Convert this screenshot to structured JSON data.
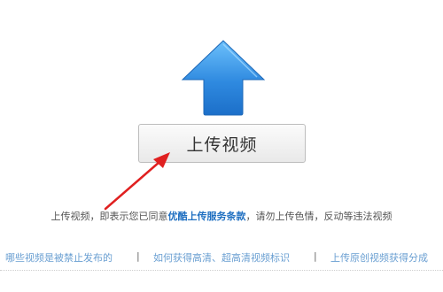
{
  "upload": {
    "button_label": "上传视频",
    "icon": "upload-arrow-icon",
    "accent_color": "#2f8ae0"
  },
  "agreement": {
    "prefix": "上传视频，即表示您已同意",
    "link": "优酷上传服务条款",
    "suffix": "，请勿上传色情，反动等违法视频"
  },
  "help_links": [
    {
      "label": "哪些视频是被禁止发布的"
    },
    {
      "label": "如何获得高清、超高清视频标识"
    },
    {
      "label": "上传原创视频获得分成"
    }
  ],
  "separator": "|"
}
